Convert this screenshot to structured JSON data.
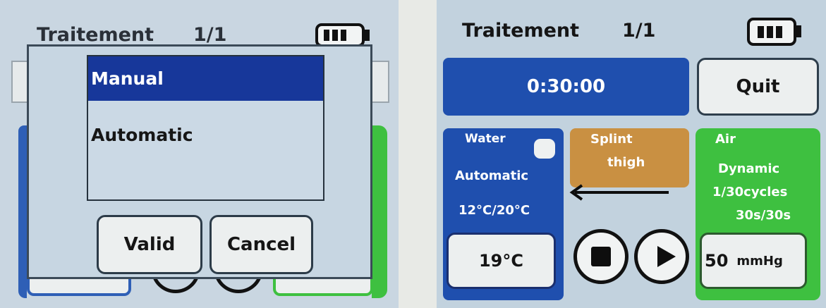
{
  "left_screen": {
    "header": {
      "title": "Traitement",
      "page": "1/1"
    },
    "mode_menu": {
      "options": [
        "Manual",
        "Automatic"
      ],
      "selected": "Manual"
    },
    "buttons": {
      "valid": "Valid",
      "cancel": "Cancel"
    }
  },
  "right_screen": {
    "header": {
      "title": "Traitement",
      "page": "1/1"
    },
    "timer": "0:30:00",
    "quit_label": "Quit",
    "water": {
      "title": "Water",
      "mode": "Automatic",
      "range": "12°C/20°C",
      "current_temp": "19°C"
    },
    "splint": {
      "line1": "Splint",
      "line2": "thigh"
    },
    "air": {
      "title": "Air",
      "mode": "Dynamic",
      "cycles": "1/30cycles",
      "timing": "30s/30s",
      "pressure": "50",
      "pressure_unit": "mmHg"
    }
  },
  "colors": {
    "screen_bg": "#c2d2de",
    "blue": "#1f4fae",
    "menu_selected": "#17379a",
    "orange": "#c99042",
    "green": "#3ec040"
  },
  "icons": [
    "battery-icon",
    "stop-icon",
    "play-icon",
    "arrow-left-icon"
  ]
}
